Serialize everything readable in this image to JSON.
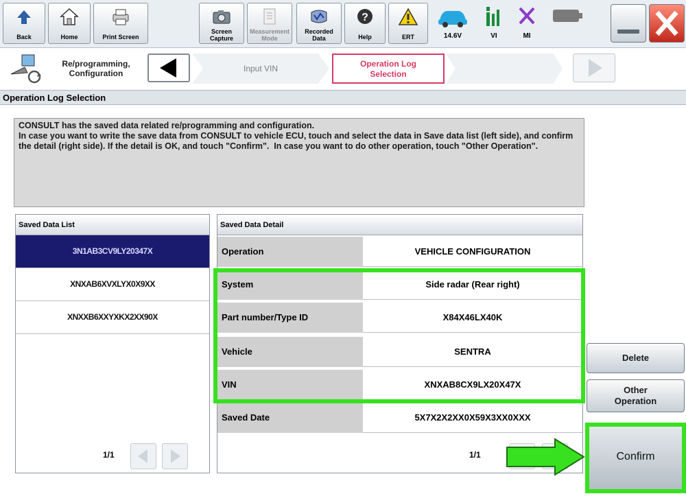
{
  "toolbar": {
    "back": "Back",
    "home": "Home",
    "print_screen": "Print Screen",
    "screen_capture": "Screen\nCapture",
    "measurement_mode": "Measurement\nMode",
    "recorded_data": "Recorded\nData",
    "help": "Help",
    "ert": "ERT",
    "voltage": "14.6V",
    "vi": "VI",
    "mi": "MI"
  },
  "nav": {
    "title": "Re/programming,\nConfiguration",
    "crumb_input_vin": "Input VIN",
    "crumb_operation_log": "Operation Log\nSelection"
  },
  "page_title": "Operation Log Selection",
  "message": "CONSULT has the saved data related re/programming and configuration.\nIn case you want to write the save data from CONSULT to vehicle ECU, touch and select the data in Save data list (left side), and confirm the detail (right side). If the detail is OK, and touch \"Confirm\".  In case you want to do other operation, touch \"Other Operation\".",
  "saved_list": {
    "header": "Saved Data List",
    "items": [
      "3N1AB3CV9LY20347X",
      "XNXAB6XVXLYX0X9XX",
      "XNXXB6XXYXKX2XX90X"
    ],
    "pager": "1/1"
  },
  "detail": {
    "header": "Saved Data Detail",
    "rows": [
      {
        "key": "Operation",
        "value": "VEHICLE CONFIGURATION"
      },
      {
        "key": "System",
        "value": "Side radar (Rear right)"
      },
      {
        "key": "Part number/Type ID",
        "value": "X84X46LX40K"
      },
      {
        "key": "Vehicle",
        "value": "SENTRA"
      },
      {
        "key": "VIN",
        "value": "XNXAB8CX9LX20X47X"
      },
      {
        "key": "Saved Date",
        "value": "5X7X2X2XX0X59X3XX0XXX"
      }
    ],
    "pager": "1/1"
  },
  "buttons": {
    "delete": "Delete",
    "other_operation": "Other\nOperation",
    "confirm": "Confirm"
  },
  "colors": {
    "highlight": "#37e11f",
    "selected_row": "#1a1a6e",
    "active_crumb": "#d63a62"
  }
}
